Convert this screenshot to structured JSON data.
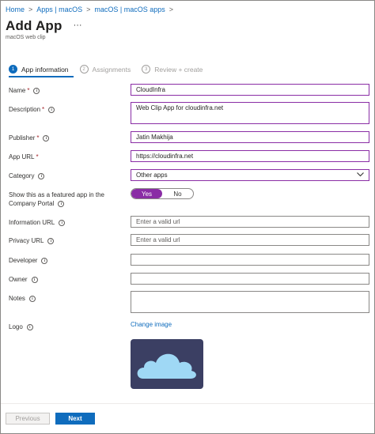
{
  "breadcrumb": {
    "items": [
      "Home",
      "Apps | macOS",
      "macOS | macOS apps"
    ],
    "separator": ">"
  },
  "header": {
    "title": "Add App",
    "more_label": "···",
    "subtitle": "macOS web clip"
  },
  "steps": [
    {
      "num": "1",
      "label": "App information",
      "active": true
    },
    {
      "num": "2",
      "label": "Assignments",
      "active": false
    },
    {
      "num": "3",
      "label": "Review + create",
      "active": false
    }
  ],
  "form": {
    "name": {
      "label": "Name",
      "required": "*",
      "value": "CloudInfra"
    },
    "description": {
      "label": "Description",
      "required": "*",
      "value": "Web Clip App for cloudinfra.net"
    },
    "publisher": {
      "label": "Publisher",
      "required": "*",
      "value": "Jatin Makhija"
    },
    "app_url": {
      "label": "App URL",
      "required": "*",
      "value": "https://cloudinfra.net"
    },
    "category": {
      "label": "Category",
      "value": "Other apps"
    },
    "featured": {
      "label_line1": "Show this as a featured app in the",
      "label_line2": "Company Portal",
      "yes": "Yes",
      "no": "No",
      "selected": "Yes"
    },
    "information_url": {
      "label": "Information URL",
      "placeholder": "Enter a valid url"
    },
    "privacy_url": {
      "label": "Privacy URL",
      "placeholder": "Enter a valid url"
    },
    "developer": {
      "label": "Developer",
      "value": ""
    },
    "owner": {
      "label": "Owner",
      "value": ""
    },
    "notes": {
      "label": "Notes",
      "value": ""
    },
    "logo": {
      "label": "Logo",
      "change_link": "Change image",
      "icon": "cloud-icon"
    }
  },
  "info_icon": "i",
  "footer": {
    "previous_label": "Previous",
    "next_label": "Next"
  },
  "colors": {
    "accent": "#0f6cbd",
    "focus_border": "#8a2da5",
    "logo_bg": "#3b3f63",
    "cloud": "#9fd8f5"
  }
}
